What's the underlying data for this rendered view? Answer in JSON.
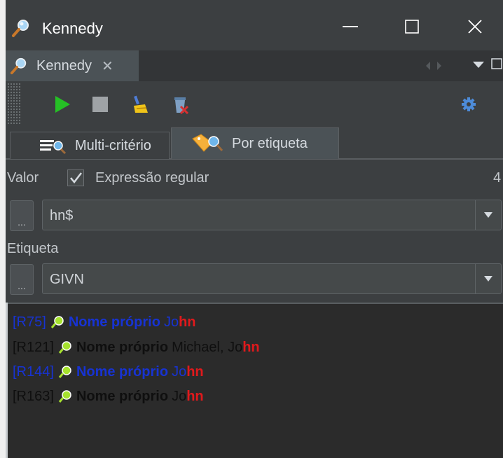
{
  "window": {
    "title": "Kennedy",
    "controls": {
      "minimize": "—",
      "maximize": "☐",
      "close": "✕"
    }
  },
  "view_tab": {
    "label": "Kennedy",
    "close": "✕"
  },
  "toolbar": {
    "buttons": [
      "play-icon",
      "stop-icon",
      "clear-broom-icon",
      "delete-results-icon"
    ],
    "settings": "gear-icon"
  },
  "tabs": [
    {
      "label": "Multi-critério",
      "icon": "multi-criteria-search-icon",
      "selected": false
    },
    {
      "label": "Por etiqueta",
      "icon": "tag-search-icon",
      "selected": true
    }
  ],
  "filter": {
    "valor_label": "Valor",
    "regex_checked": true,
    "regex_label": "Expressão regular",
    "count": "4",
    "value_button": "...",
    "value": "hn$",
    "etiqueta_label": "Etiqueta",
    "tag_button": "...",
    "tag_value": "GIVN"
  },
  "results": [
    {
      "id": "[R75]",
      "tag": "Nome próprio",
      "pre": "Jo",
      "match": "hn",
      "selected": true
    },
    {
      "id": "[R121]",
      "tag": "Nome próprio",
      "pre": "Michael, Jo",
      "match": "hn",
      "selected": false
    },
    {
      "id": "[R144]",
      "tag": "Nome próprio",
      "pre": "Jo",
      "match": "hn",
      "selected": true
    },
    {
      "id": "[R163]",
      "tag": "Nome próprio",
      "pre": "Jo",
      "match": "hn",
      "selected": false
    }
  ],
  "colors": {
    "background": "#3c3f41",
    "results_bg": "#2b2b2b",
    "selected_text": "#1733d3",
    "match": "#e0191c",
    "play": "#25c025"
  }
}
